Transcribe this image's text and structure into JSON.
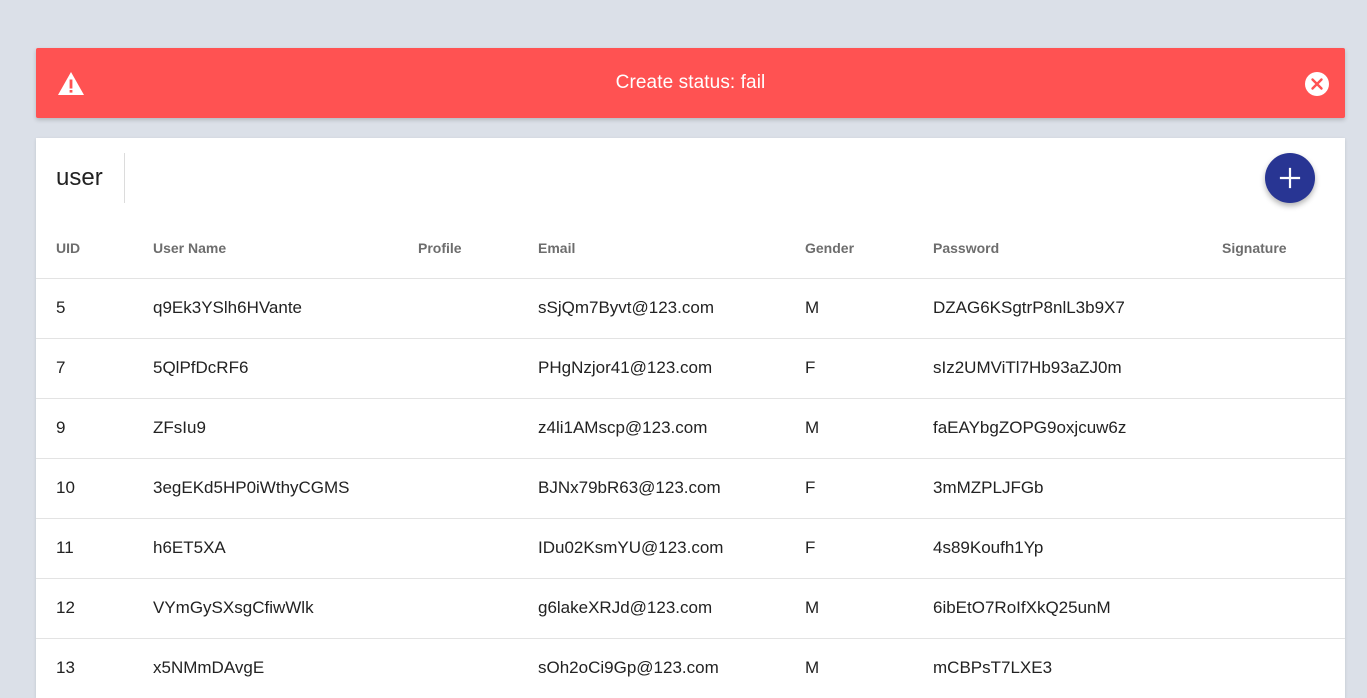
{
  "alert": {
    "icon": "warning-icon",
    "message": "Create status: fail",
    "close_icon": "close-circle-icon",
    "color": "#ff5252"
  },
  "card": {
    "title": "user",
    "add_icon": "plus-icon",
    "accent": "#283593"
  },
  "table": {
    "columns": [
      "UID",
      "User Name",
      "Profile",
      "Email",
      "Gender",
      "Password",
      "Signature"
    ],
    "rows": [
      {
        "uid": "5",
        "username": "q9Ek3YSlh6HVante",
        "profile": "",
        "email": "sSjQm7Byvt@123.com",
        "gender": "M",
        "password": "DZAG6KSgtrP8nlL3b9X7",
        "signature": ""
      },
      {
        "uid": "7",
        "username": "5QlPfDcRF6",
        "profile": "",
        "email": "PHgNzjor41@123.com",
        "gender": "F",
        "password": "sIz2UMViTl7Hb93aZJ0m",
        "signature": ""
      },
      {
        "uid": "9",
        "username": "ZFsIu9",
        "profile": "",
        "email": "z4li1AMscp@123.com",
        "gender": "M",
        "password": "faEAYbgZOPG9oxjcuw6z",
        "signature": ""
      },
      {
        "uid": "10",
        "username": "3egEKd5HP0iWthyCGMS",
        "profile": "",
        "email": "BJNx79bR63@123.com",
        "gender": "F",
        "password": "3mMZPLJFGb",
        "signature": ""
      },
      {
        "uid": "11",
        "username": "h6ET5XA",
        "profile": "",
        "email": "IDu02KsmYU@123.com",
        "gender": "F",
        "password": "4s89Koufh1Yp",
        "signature": ""
      },
      {
        "uid": "12",
        "username": "VYmGySXsgCfiwWlk",
        "profile": "",
        "email": "g6lakeXRJd@123.com",
        "gender": "M",
        "password": "6ibEtO7RoIfXkQ25unM",
        "signature": ""
      },
      {
        "uid": "13",
        "username": "x5NMmDAvgE",
        "profile": "",
        "email": "sOh2oCi9Gp@123.com",
        "gender": "M",
        "password": "mCBPsT7LXE3",
        "signature": ""
      }
    ]
  }
}
